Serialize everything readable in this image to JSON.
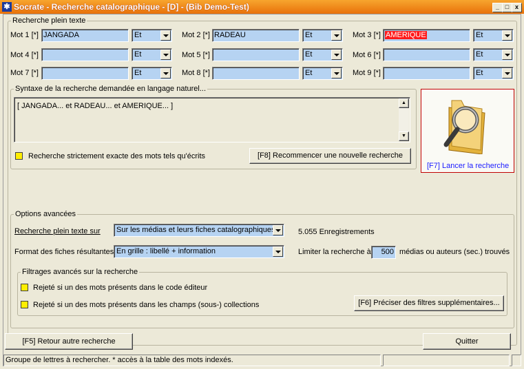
{
  "window": {
    "title": "Socrate - Recherche catalographique - [D] - (Bib Demo-Test)",
    "app_icon": "app-icon",
    "controls": [
      "minimize-icon",
      "maximize-icon",
      "close-icon"
    ],
    "control_glyphs": {
      "minimize": "_",
      "maximize": "□",
      "close": "x"
    }
  },
  "plein_texte": {
    "legend": "Recherche plein texte",
    "mots": [
      {
        "label": "Mot 1 [*]",
        "value": "JANGADA",
        "op": "Et",
        "highlight": false
      },
      {
        "label": "Mot 2 [*]",
        "value": "RADEAU",
        "op": "Et",
        "highlight": false
      },
      {
        "label": "Mot 3 [*]",
        "value": "AMERIQUE",
        "op": "Et",
        "highlight": true
      },
      {
        "label": "Mot 4 [*]",
        "value": "",
        "op": "Et",
        "highlight": false
      },
      {
        "label": "Mot 5 [*]",
        "value": "",
        "op": "Et",
        "highlight": false
      },
      {
        "label": "Mot 6 [*]",
        "value": "",
        "op": "Et",
        "highlight": false
      },
      {
        "label": "Mot 7 [*]",
        "value": "",
        "op": "Et",
        "highlight": false
      },
      {
        "label": "Mot 8 [*]",
        "value": "",
        "op": "Et",
        "highlight": false
      },
      {
        "label": "Mot 9 [*]",
        "value": "",
        "op": "Et",
        "highlight": false
      }
    ]
  },
  "syntaxe": {
    "legend": "Syntaxe de la recherche demandée en langage naturel...",
    "text": "[ JANGADA... et RADEAU... et AMERIQUE... ]",
    "exact_label": "Recherche strictement exacte des mots tels qu'écrits",
    "restart_button": "[F8] Recommencer une nouvelle recherche"
  },
  "lancer": {
    "label": "[F7] Lancer la recherche",
    "icon": "folder-search-icon",
    "label_color": "#1a1aff"
  },
  "options": {
    "legend": "Options avancées",
    "recherche_sur_label": "Recherche plein texte sur",
    "recherche_sur_value": "Sur les médias et leurs fiches catalographiques",
    "enregistrements": "5.055 Enregistrements",
    "format_label": "Format des fiches résultantes",
    "format_value": "En grille : libellé + information",
    "limiter_label": "Limiter la recherche à",
    "limiter_value": "500",
    "limiter_suffix": "médias ou auteurs (sec.) trouvés"
  },
  "filtrages": {
    "legend": "Filtrages avancés sur la recherche",
    "items": [
      "Rejeté si un des mots présents dans le code éditeur",
      "Rejeté si un des mots présents dans les champs (sous-) collections"
    ],
    "more_button": "[F6] Préciser des filtres supplémentaires..."
  },
  "footer": {
    "retour_button": "[F5] Retour autre recherche",
    "quitter_button": "Quitter"
  },
  "status": {
    "text": "Groupe de lettres à rechercher. * accès à la table des mots indexés."
  },
  "colors": {
    "titlebar": "#e8710a",
    "field_bg": "#b6d3f2",
    "checkbox": "#ffee00",
    "highlight": "#ff1a1a",
    "lancer_border": "#c00000"
  }
}
